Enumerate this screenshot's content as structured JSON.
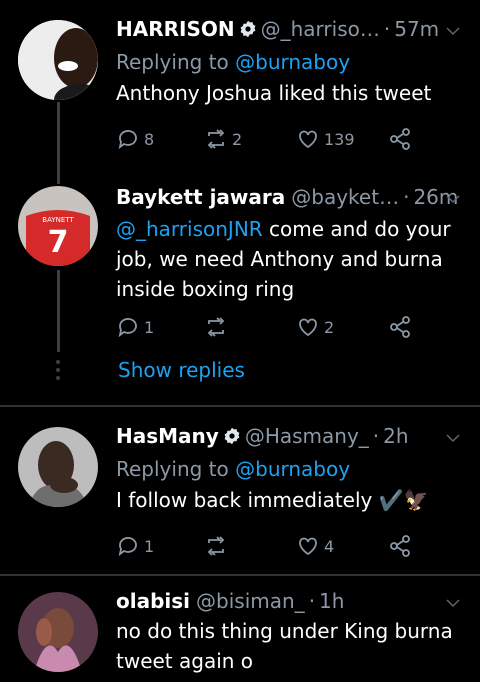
{
  "tweets": [
    {
      "name": "HARRISON",
      "verified": true,
      "handle": "@_harriso…",
      "time": "57m",
      "replying_prefix": "Replying to",
      "replying_to": "@burnaboy",
      "text": "Anthony Joshua liked this tweet",
      "replies": "8",
      "retweets": "2",
      "likes": "139"
    },
    {
      "name": "Baykett jawara",
      "verified": false,
      "handle": "@bayket…",
      "time": "26m",
      "mention": "@_harrisonJNR",
      "text_line1_rest": " come and do your",
      "text_rest": "job, we need Anthony and burna inside boxing ring",
      "jersey_name": "BAYNETT",
      "jersey_number": "7",
      "replies": "1",
      "retweets": "",
      "likes": "2"
    },
    {
      "name": "HasMany",
      "verified": true,
      "handle": "@Hasmany_",
      "time": "2h",
      "replying_prefix": "Replying to",
      "replying_to": "@burnaboy",
      "text": "I follow back immediately ✔️🦅",
      "replies": "1",
      "retweets": "",
      "likes": "4"
    },
    {
      "name": "olabisi",
      "verified": false,
      "handle": "@bisiman_",
      "time": "1h",
      "text": "no do this thing under King burna tweet again o"
    }
  ],
  "show_replies": "Show replies",
  "dot_separator": "·",
  "colors": {
    "background": "#000000",
    "text": "#ffffff",
    "secondary": "#8b98a5",
    "link": "#1da1f2",
    "divider": "#2f3336"
  }
}
